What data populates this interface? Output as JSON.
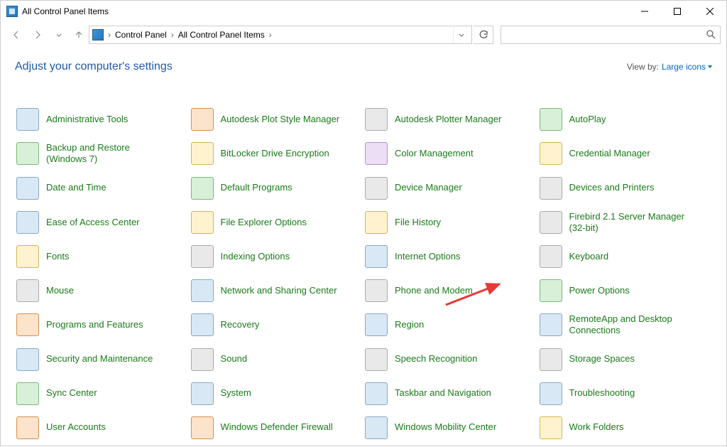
{
  "window": {
    "title": "All Control Panel Items"
  },
  "breadcrumb": {
    "parts": [
      "Control Panel",
      "All Control Panel Items"
    ]
  },
  "header": {
    "adjust": "Adjust your computer's settings",
    "viewby_label": "View by:",
    "viewby_value": "Large icons"
  },
  "items": [
    {
      "label": "Administrative Tools",
      "icon": "tools-icon",
      "col": "blue"
    },
    {
      "label": "Autodesk Plot Style Manager",
      "icon": "autodesk-plot-icon",
      "col": "orange"
    },
    {
      "label": "Autodesk Plotter Manager",
      "icon": "autodesk-plotter-icon",
      "col": "gray"
    },
    {
      "label": "AutoPlay",
      "icon": "autoplay-icon",
      "col": "green"
    },
    {
      "label": "Backup and Restore (Windows 7)",
      "icon": "backup-icon",
      "col": "green"
    },
    {
      "label": "BitLocker Drive Encryption",
      "icon": "bitlocker-icon",
      "col": "yellow"
    },
    {
      "label": "Color Management",
      "icon": "color-icon",
      "col": "purple"
    },
    {
      "label": "Credential Manager",
      "icon": "credential-icon",
      "col": "yellow"
    },
    {
      "label": "Date and Time",
      "icon": "datetime-icon",
      "col": "blue"
    },
    {
      "label": "Default Programs",
      "icon": "default-programs-icon",
      "col": "green"
    },
    {
      "label": "Device Manager",
      "icon": "device-manager-icon",
      "col": "gray"
    },
    {
      "label": "Devices and Printers",
      "icon": "devices-printers-icon",
      "col": "gray"
    },
    {
      "label": "Ease of Access Center",
      "icon": "ease-access-icon",
      "col": "blue"
    },
    {
      "label": "File Explorer Options",
      "icon": "file-explorer-icon",
      "col": "yellow"
    },
    {
      "label": "File History",
      "icon": "file-history-icon",
      "col": "yellow"
    },
    {
      "label": "Firebird 2.1 Server Manager (32-bit)",
      "icon": "firebird-icon",
      "col": "gray"
    },
    {
      "label": "Fonts",
      "icon": "fonts-icon",
      "col": "yellow"
    },
    {
      "label": "Indexing Options",
      "icon": "indexing-icon",
      "col": "gray"
    },
    {
      "label": "Internet Options",
      "icon": "internet-icon",
      "col": "blue"
    },
    {
      "label": "Keyboard",
      "icon": "keyboard-icon",
      "col": "gray"
    },
    {
      "label": "Mouse",
      "icon": "mouse-icon",
      "col": "gray"
    },
    {
      "label": "Network and Sharing Center",
      "icon": "network-icon",
      "col": "blue"
    },
    {
      "label": "Phone and Modem",
      "icon": "phone-icon",
      "col": "gray"
    },
    {
      "label": "Power Options",
      "icon": "power-icon",
      "col": "green"
    },
    {
      "label": "Programs and Features",
      "icon": "programs-icon",
      "col": "orange"
    },
    {
      "label": "Recovery",
      "icon": "recovery-icon",
      "col": "blue"
    },
    {
      "label": "Region",
      "icon": "region-icon",
      "col": "blue"
    },
    {
      "label": "RemoteApp and Desktop Connections",
      "icon": "remoteapp-icon",
      "col": "blue"
    },
    {
      "label": "Security and Maintenance",
      "icon": "security-icon",
      "col": "blue"
    },
    {
      "label": "Sound",
      "icon": "sound-icon",
      "col": "gray"
    },
    {
      "label": "Speech Recognition",
      "icon": "speech-icon",
      "col": "gray"
    },
    {
      "label": "Storage Spaces",
      "icon": "storage-icon",
      "col": "gray"
    },
    {
      "label": "Sync Center",
      "icon": "sync-icon",
      "col": "green"
    },
    {
      "label": "System",
      "icon": "system-icon",
      "col": "blue"
    },
    {
      "label": "Taskbar and Navigation",
      "icon": "taskbar-icon",
      "col": "blue"
    },
    {
      "label": "Troubleshooting",
      "icon": "troubleshoot-icon",
      "col": "blue"
    },
    {
      "label": "User Accounts",
      "icon": "users-icon",
      "col": "orange"
    },
    {
      "label": "Windows Defender Firewall",
      "icon": "firewall-icon",
      "col": "orange"
    },
    {
      "label": "Windows Mobility Center",
      "icon": "mobility-icon",
      "col": "blue"
    },
    {
      "label": "Work Folders",
      "icon": "work-folders-icon",
      "col": "yellow"
    }
  ]
}
